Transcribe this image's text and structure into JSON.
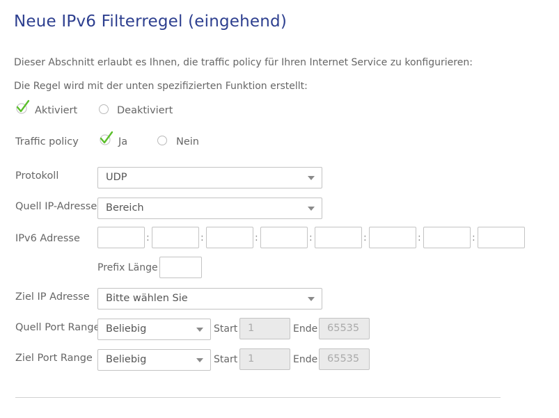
{
  "page": {
    "title": "Neue IPv6 Filterregel (eingehend)",
    "intro": "Dieser Abschnitt erlaubt es Ihnen, die traffic policy für Ihren Internet Service zu konfigurieren:",
    "rule_text": "Die Regel wird mit der unten spezifizierten Funktion erstellt:"
  },
  "status": {
    "active_label": "Aktiviert",
    "inactive_label": "Deaktiviert",
    "selected": "Aktiviert"
  },
  "traffic_policy": {
    "label": "Traffic policy",
    "yes_label": "Ja",
    "no_label": "Nein",
    "selected": "Ja"
  },
  "protocol": {
    "label": "Protokoll",
    "value": "UDP"
  },
  "source_ip": {
    "label": "Quell IP-Adresse",
    "value": "Bereich"
  },
  "ipv6": {
    "label": "IPv6 Adresse",
    "separator": ":",
    "prefix_label": "Prefix Länge"
  },
  "dest_ip": {
    "label": "Ziel IP Adresse",
    "value": "Bitte wählen Sie"
  },
  "source_port": {
    "label": "Quell Port Range",
    "value": "Beliebig",
    "start_label": "Start",
    "start_value": "1",
    "end_label": "Ende",
    "end_value": "65535"
  },
  "dest_port": {
    "label": "Ziel Port Range",
    "value": "Beliebig",
    "start_label": "Start",
    "start_value": "1",
    "end_label": "Ende",
    "end_value": "65535"
  },
  "colors": {
    "title": "#2d3f8f",
    "checkmark": "#5bbf2a",
    "text": "#666666"
  },
  "icons": {
    "checked": "checkmark-icon",
    "unchecked": "radio-empty-icon",
    "dropdown": "caret-down-icon"
  }
}
